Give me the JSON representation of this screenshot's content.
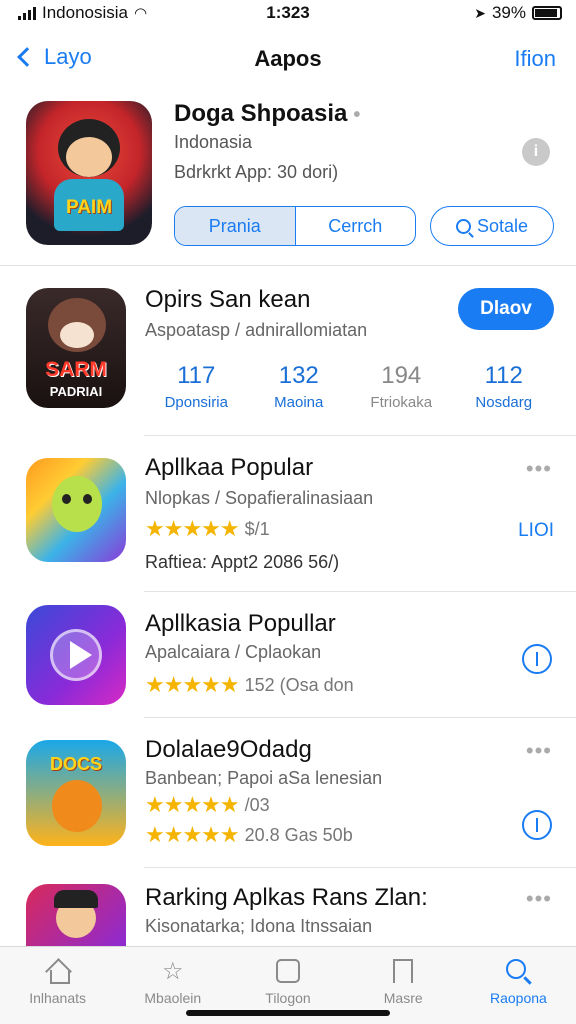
{
  "status_bar": {
    "carrier": "Indonosisia",
    "time": "1:323",
    "battery": "39%"
  },
  "nav": {
    "back_label": "Layo",
    "title": "Aapos",
    "action_label": "Ifion"
  },
  "header": {
    "app_name": "Doga Shpoasia",
    "dot": "•",
    "subtitle": "Indonasia",
    "rating_text": "Bdrkrkt  App: 30 dori)",
    "info_icon": "i",
    "icon_text": "PAIM",
    "segments": [
      "Prania",
      "Cerrch"
    ],
    "search_button": "Sotale"
  },
  "featured": {
    "name": "Opirs San kean",
    "subtitle": "Aspoatasp / adnirallomiatan",
    "get_button": "Dlaov",
    "icon_text": "SARM",
    "icon_text2": "PADRIAI",
    "stats": [
      {
        "value": "117",
        "label": "Dponsiria"
      },
      {
        "value": "132",
        "label": "Maoina"
      },
      {
        "value": "194",
        "label": "Ftriokaka"
      },
      {
        "value": "112",
        "label": "Nosdarg"
      }
    ]
  },
  "apps": [
    {
      "name": "Apllkaa Popular",
      "subtitle": "Nlopkas / Sopafieralinasiaan",
      "stars": "★★★★★",
      "rating_note": "$/1",
      "extra_line": "Raftiea: Appt2 2086 56/)",
      "right_text": "LIOI"
    },
    {
      "name": "Apllkasia Popullar",
      "subtitle": "Apalcaiara / Cplaokan",
      "stars": "★★★★★",
      "rating_note": "152  (Osa don"
    },
    {
      "name": "Dolalae9Odadɡ",
      "subtitle": "Banbean; Papoi aSa lenesian",
      "stars": "★★★★★",
      "rating_note": "/03",
      "stars2": "★★★★★",
      "rating_note2": "20.8 Gas 50b",
      "icon_text": "DOCS"
    },
    {
      "name": "Rarking Aplkas Rans Zlan:",
      "subtitle": "Kisonatarka; Idona Itnssaian"
    }
  ],
  "tabs": [
    {
      "label": "Inlhanats",
      "icon": "home-icon"
    },
    {
      "label": "Mbaolein",
      "icon": "star-box-icon"
    },
    {
      "label": "Tilogon",
      "icon": "apps-icon"
    },
    {
      "label": "Masre",
      "icon": "bookmark-icon"
    },
    {
      "label": "Raopona",
      "icon": "search-icon"
    }
  ],
  "colors": {
    "accent": "#1a7cf2",
    "star": "#f4b400",
    "separator": "#e2e2e2"
  }
}
